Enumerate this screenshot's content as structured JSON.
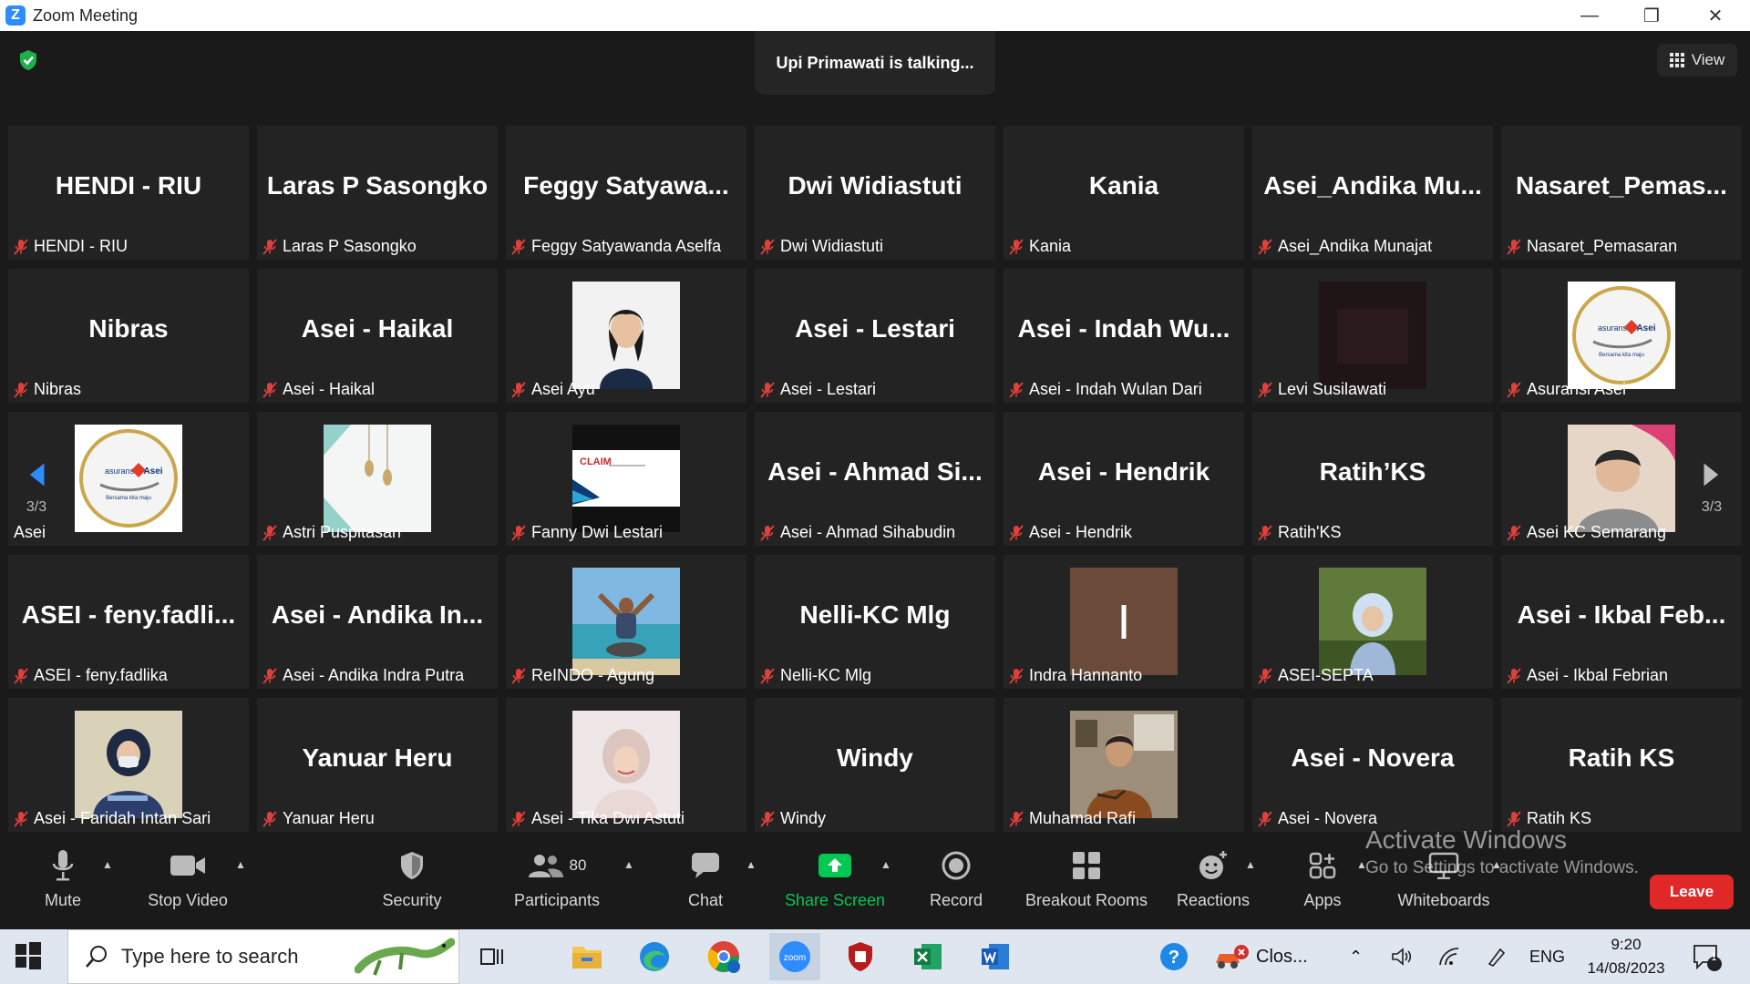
{
  "window": {
    "title": "Zoom Meeting",
    "logo_letter": "Z"
  },
  "meeting": {
    "talking_indicator": "Upi Primawati is talking...",
    "view_label": "View",
    "page_indicator_left": "3/3",
    "page_indicator_right": "3/3",
    "tiles": [
      {
        "big": "HENDI - RIU",
        "name": "HENDI - RIU"
      },
      {
        "big": "Laras P Sasongko",
        "name": "Laras P Sasongko"
      },
      {
        "big": "Feggy  Satyawa...",
        "name": "Feggy Satyawanda Aselfa"
      },
      {
        "big": "Dwi Widiastuti",
        "name": "Dwi Widiastuti"
      },
      {
        "big": "Kania",
        "name": "Kania"
      },
      {
        "big": "Asei_Andika  Mu...",
        "name": "Asei_Andika Munajat"
      },
      {
        "big": "Nasaret_Pemas...",
        "name": "Nasaret_Pemasaran"
      },
      {
        "big": "Nibras",
        "name": "Nibras"
      },
      {
        "big": "Asei - Haikal",
        "name": "Asei - Haikal"
      },
      {
        "big": "",
        "name": "Asei Ayu",
        "avatar": "woman-portrait"
      },
      {
        "big": "Asei - Lestari",
        "name": "Asei - Lestari"
      },
      {
        "big": "Asei  - Indah Wu...",
        "name": "Asei - Indah Wulan Dari"
      },
      {
        "big": "",
        "name": "Levi Susilawati",
        "avatar": "dark-photo"
      },
      {
        "big": "",
        "name": "Asuransi Asei",
        "avatar": "asei-logo",
        "logo_text": "asuransi Asei",
        "logo_sub": "Bersama kita maju"
      },
      {
        "big": "",
        "name": "Asei",
        "avatar": "asei-logo",
        "logo_text": "asuransi Asei",
        "logo_sub": "Bersama kita maju",
        "no_mic": true
      },
      {
        "big": "",
        "name": "Astri Puspitasari",
        "avatar": "ornament-lanterns"
      },
      {
        "big": "",
        "name": "Fanny Dwi Lestari",
        "avatar": "claim-slide",
        "slide_text": "CLAIM"
      },
      {
        "big": "Asei  - Ahmad Si...",
        "name": "Asei - Ahmad Sihabudin"
      },
      {
        "big": "Asei - Hendrik",
        "name": "Asei - Hendrik"
      },
      {
        "big": "Ratih’KS",
        "name": "Ratih'KS"
      },
      {
        "big": "",
        "name": "Asei KC Semarang",
        "avatar": "child-photo"
      },
      {
        "big": "ASEI  - feny.fadli...",
        "name": "ASEI - feny.fadlika"
      },
      {
        "big": "Asei  - Andika In...",
        "name": "Asei - Andika Indra Putra"
      },
      {
        "big": "",
        "name": "ReINDO - Agung",
        "avatar": "beach-photo"
      },
      {
        "big": "Nelli-KC Mlg",
        "name": "Nelli-KC Mlg"
      },
      {
        "big": "",
        "name": "Indra Hannanto",
        "avatar": "letter-avatar",
        "letter": "I"
      },
      {
        "big": "",
        "name": "ASEI-SEPTA",
        "avatar": "hijab-outdoor-photo"
      },
      {
        "big": "Asei  - Ikbal Feb...",
        "name": "Asei - Ikbal Febrian"
      },
      {
        "big": "",
        "name": "Asei - Faridah Intan Sari",
        "avatar": "hijab-mask-photo"
      },
      {
        "big": "Yanuar Heru",
        "name": "Yanuar Heru"
      },
      {
        "big": "",
        "name": "Asei - Tika Dwi Astuti",
        "avatar": "hijab-portrait"
      },
      {
        "big": "Windy",
        "name": "Windy"
      },
      {
        "big": "",
        "name": "Muhamad Rafi",
        "avatar": "man-photo"
      },
      {
        "big": "Asei - Novera",
        "name": "Asei - Novera"
      },
      {
        "big": "Ratih KS",
        "name": "Ratih KS"
      }
    ]
  },
  "toolbar": {
    "mute": "Mute",
    "stop_video": "Stop Video",
    "security": "Security",
    "participants": "Participants",
    "participants_count": "80",
    "chat": "Chat",
    "share_screen": "Share Screen",
    "record": "Record",
    "breakout_rooms": "Breakout Rooms",
    "reactions": "Reactions",
    "apps": "Apps",
    "whiteboards": "Whiteboards",
    "leave": "Leave"
  },
  "watermark": {
    "line1": "Activate Windows",
    "line2": "Go to Settings to activate Windows."
  },
  "taskbar": {
    "search_placeholder": "Type here to search",
    "task_label": "Clos...",
    "language": "ENG",
    "time": "9:20",
    "date": "14/08/2023",
    "notification_count": "1"
  },
  "colors": {
    "accent": "#2d8cff",
    "share": "#00c851",
    "leave": "#e02828",
    "muted": "#e0403a"
  }
}
